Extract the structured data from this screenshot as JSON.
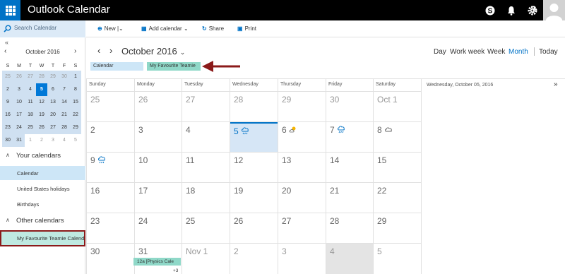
{
  "topbar": {
    "app_title": "Outlook Calendar",
    "icons": [
      "waffle-icon",
      "skype-icon",
      "bell-icon",
      "gear-icon",
      "help-icon",
      "avatar"
    ],
    "help_label": "?"
  },
  "search": {
    "placeholder": "Search Calendar"
  },
  "mini_calendar": {
    "collapse": "«",
    "prev": "‹",
    "next": "›",
    "title": "October 2016",
    "weekdays": [
      "S",
      "M",
      "T",
      "W",
      "T",
      "F",
      "S"
    ],
    "weeks": [
      [
        "25",
        "26",
        "27",
        "28",
        "29",
        "30",
        "1"
      ],
      [
        "2",
        "3",
        "4",
        "5",
        "6",
        "7",
        "8"
      ],
      [
        "9",
        "10",
        "11",
        "12",
        "13",
        "14",
        "15"
      ],
      [
        "16",
        "17",
        "18",
        "19",
        "20",
        "21",
        "22"
      ],
      [
        "23",
        "24",
        "25",
        "26",
        "27",
        "28",
        "29"
      ],
      [
        "30",
        "31",
        "1",
        "2",
        "3",
        "4",
        "5"
      ]
    ],
    "today": "5"
  },
  "your_calendars": {
    "title": "Your calendars",
    "items": [
      "Calendar",
      "United States holidays",
      "Birthdays"
    ]
  },
  "other_calendars": {
    "title": "Other calendars",
    "items": [
      "My Favourite Teamie Calendar"
    ]
  },
  "toolbar": {
    "new_label": "New",
    "new_dropdown": "|⌄",
    "add_calendar_label": "Add calendar",
    "share_label": "Share",
    "print_label": "Print"
  },
  "header": {
    "prev": "‹",
    "next": "›",
    "month_title": "October 2016",
    "month_dropdown": "⌄",
    "views": [
      "Day",
      "Work week",
      "Week",
      "Month",
      "Today"
    ],
    "active_view": "Month"
  },
  "chips": {
    "calendar": "Calendar",
    "teamie": "My Favourite Teamie"
  },
  "month_grid": {
    "weekdays": [
      "Sunday",
      "Monday",
      "Tuesday",
      "Wednesday",
      "Thursday",
      "Friday",
      "Saturday"
    ],
    "weeks": [
      [
        "25",
        "26",
        "27",
        "28",
        "29",
        "30",
        "Oct 1"
      ],
      [
        "2",
        "3",
        "4",
        "5",
        "6",
        "7",
        "8"
      ],
      [
        "9",
        "10",
        "11",
        "12",
        "13",
        "14",
        "15"
      ],
      [
        "16",
        "17",
        "18",
        "19",
        "20",
        "21",
        "22"
      ],
      [
        "23",
        "24",
        "25",
        "26",
        "27",
        "28",
        "29"
      ],
      [
        "30",
        "31",
        "Nov 1",
        "2",
        "3",
        "4",
        "5"
      ]
    ],
    "event": "12a [Physics Cale",
    "more": "+3"
  },
  "right_pane": {
    "date": "Wednesday, October 05, 2016",
    "expand": "»"
  },
  "colors": {
    "brand_blue": "#0072c6",
    "teamie_teal": "#8fd8c8",
    "today_fill": "#d6e6f6",
    "annotation_red": "#8b1a1a"
  }
}
